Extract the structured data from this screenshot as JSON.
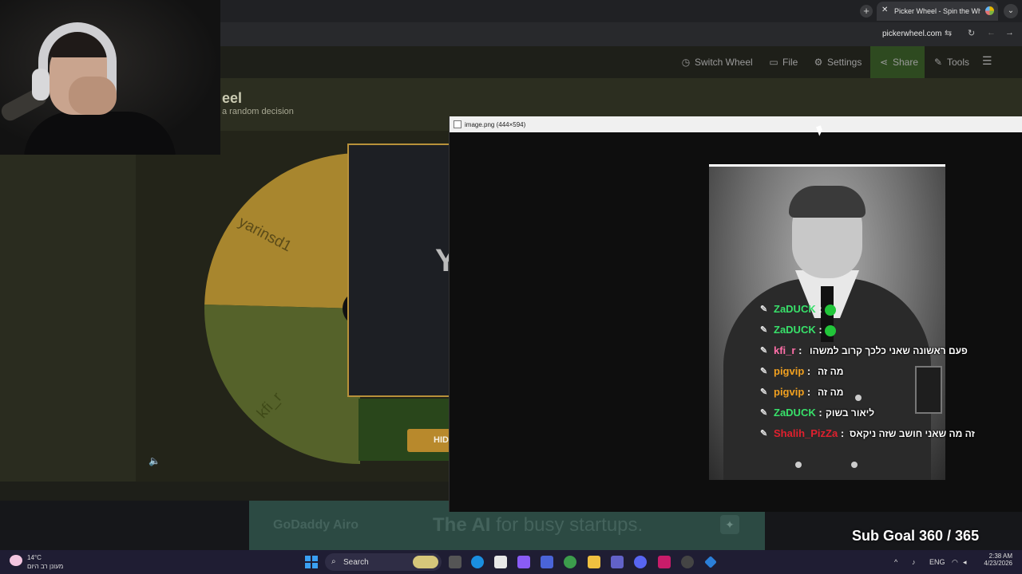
{
  "browser": {
    "tab_title": "Picker Wheel - Spin the Wheel",
    "url": "pickerwheel.com",
    "new_tab_symbol": "+",
    "close_symbol": "✕",
    "menu_symbol": "⌄"
  },
  "site": {
    "nav": {
      "switch_wheel": "Switch Wheel",
      "file": "File",
      "settings": "Settings",
      "share": "Share",
      "tools": "Tools"
    },
    "hero_title": "eel",
    "hero_subtitle": "a random decision",
    "wheel": {
      "segments": [
        "yarinsd1",
        "kfi_r"
      ],
      "colors": {
        "segment1": "#a8862e",
        "segment2": "#55622a",
        "accent": "#b8892c"
      }
    },
    "result_letter": "Y",
    "hide_button": "HID"
  },
  "ad": {
    "logo": "GoDaddy Airo",
    "text_bold": "The AI",
    "text_rest": " for busy startups."
  },
  "image_viewer": {
    "title": "image.png (444×594)"
  },
  "chat": [
    {
      "user": "ZaDUCK",
      "color": "#38e06a",
      "message": "",
      "emote": true
    },
    {
      "user": "ZaDUCK",
      "color": "#38e06a",
      "message": "",
      "emote": true
    },
    {
      "user": "kfi_r",
      "color": "#ff6fa8",
      "message": "פעם ראשונה שאני כלכך קרוב למשהו",
      "emote": false
    },
    {
      "user": "pigvip",
      "color": "#f0a020",
      "message": "מה זה",
      "emote": false
    },
    {
      "user": "pigvip",
      "color": "#f0a020",
      "message": "מה זה",
      "emote": false
    },
    {
      "user": "ZaDUCK",
      "color": "#38e06a",
      "message": "ליאור בשוק",
      "emote": false
    },
    {
      "user": "Shalih_PizZa",
      "color": "#e0202e",
      "message": "זה מה שאני חושב שזה ניקאס",
      "emote": false
    }
  ],
  "chat_separator": " :",
  "sub_goal": "Sub Goal 360 / 365",
  "taskbar": {
    "temperature": "14°C",
    "weather_condition": "מעונן רב היום",
    "search_label": "Search",
    "language": "ENG",
    "time": "2:38 AM",
    "date": "4/23/2026"
  }
}
